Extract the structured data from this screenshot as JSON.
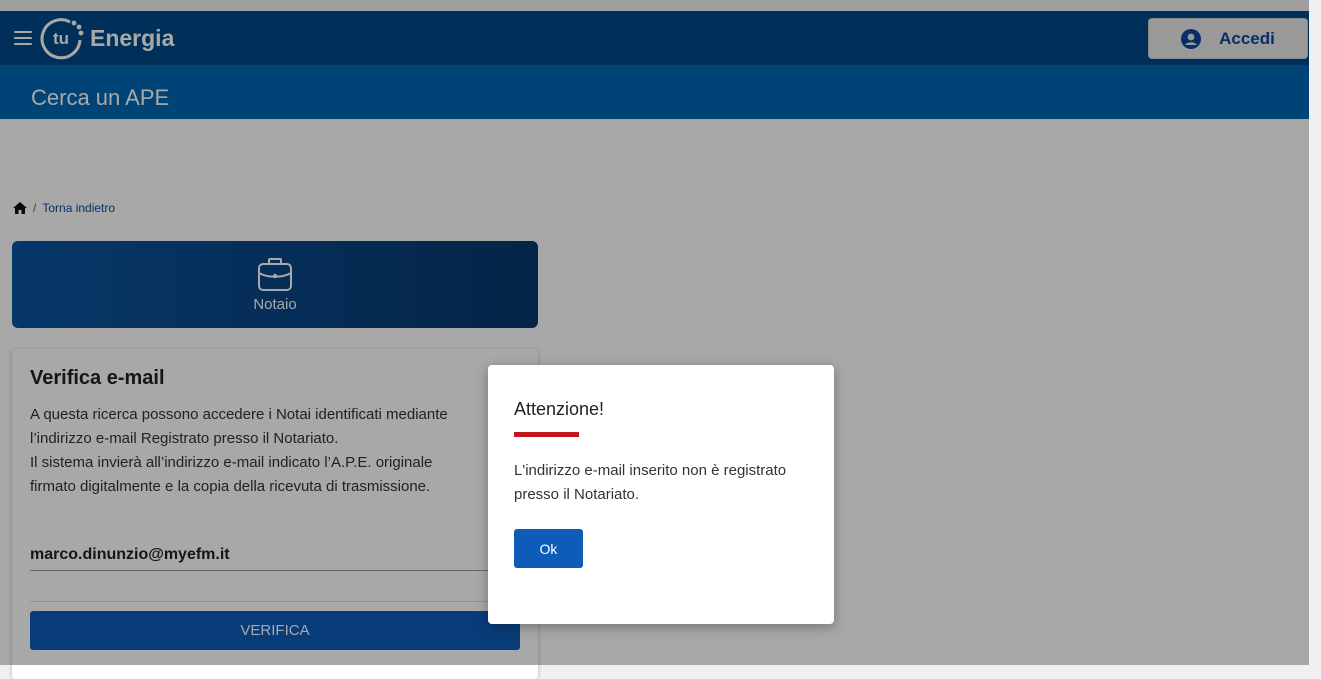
{
  "header": {
    "logo_mark": "tu",
    "logo_text": "Energia",
    "login_label": "Accedi"
  },
  "subheader": {
    "title": "Cerca un APE"
  },
  "breadcrumb": {
    "back_label": "Torna indietro"
  },
  "role_card": {
    "label": "Notaio"
  },
  "verify": {
    "title": "Verifica e-mail",
    "desc_lines": [
      "A questa ricerca possono accedere i Notai identificati mediante",
      "l’indirizzo e-mail Registrato presso il Notariato.",
      "Il sistema invierà all’indirizzo e-mail indicato l’A.P.E. originale",
      "firmato digitalmente e la copia della ricevuta di trasmissione."
    ],
    "email_value": "marco.dinunzio@myefm.it",
    "button_label": "VERIFICA"
  },
  "modal": {
    "title": "Attenzione!",
    "message": "L'indirizzo e-mail inserito non è registrato presso il Notariato.",
    "ok_label": "Ok"
  },
  "colors": {
    "header_bg": "#004a88",
    "subheader_bg": "#0066b3",
    "primary_button": "#0d5cb8",
    "accent_red": "#c1161b"
  }
}
